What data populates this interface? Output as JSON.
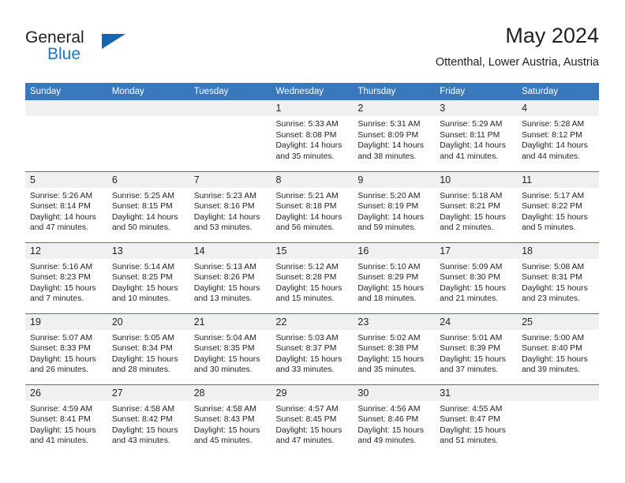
{
  "brand": {
    "name_part1": "General",
    "name_part2": "Blue",
    "triangle_color": "#1565b0",
    "blue_text_color": "#1a79c8"
  },
  "header": {
    "title": "May 2024",
    "location": "Ottenthal, Lower Austria, Austria",
    "header_bg": "#3a78bd",
    "daynum_bg": "#f0f0f0"
  },
  "weekday_headers": [
    "Sunday",
    "Monday",
    "Tuesday",
    "Wednesday",
    "Thursday",
    "Friday",
    "Saturday"
  ],
  "labels": {
    "sunrise_prefix": "Sunrise:",
    "sunset_prefix": "Sunset:",
    "daylight_prefix": "Daylight:"
  },
  "weeks": [
    [
      {
        "day": "",
        "sunrise": "",
        "sunset": "",
        "daylight_line1": "",
        "daylight_line2": ""
      },
      {
        "day": "",
        "sunrise": "",
        "sunset": "",
        "daylight_line1": "",
        "daylight_line2": ""
      },
      {
        "day": "",
        "sunrise": "",
        "sunset": "",
        "daylight_line1": "",
        "daylight_line2": ""
      },
      {
        "day": "1",
        "sunrise": "Sunrise: 5:33 AM",
        "sunset": "Sunset: 8:08 PM",
        "daylight_line1": "Daylight: 14 hours",
        "daylight_line2": "and 35 minutes."
      },
      {
        "day": "2",
        "sunrise": "Sunrise: 5:31 AM",
        "sunset": "Sunset: 8:09 PM",
        "daylight_line1": "Daylight: 14 hours",
        "daylight_line2": "and 38 minutes."
      },
      {
        "day": "3",
        "sunrise": "Sunrise: 5:29 AM",
        "sunset": "Sunset: 8:11 PM",
        "daylight_line1": "Daylight: 14 hours",
        "daylight_line2": "and 41 minutes."
      },
      {
        "day": "4",
        "sunrise": "Sunrise: 5:28 AM",
        "sunset": "Sunset: 8:12 PM",
        "daylight_line1": "Daylight: 14 hours",
        "daylight_line2": "and 44 minutes."
      }
    ],
    [
      {
        "day": "5",
        "sunrise": "Sunrise: 5:26 AM",
        "sunset": "Sunset: 8:14 PM",
        "daylight_line1": "Daylight: 14 hours",
        "daylight_line2": "and 47 minutes."
      },
      {
        "day": "6",
        "sunrise": "Sunrise: 5:25 AM",
        "sunset": "Sunset: 8:15 PM",
        "daylight_line1": "Daylight: 14 hours",
        "daylight_line2": "and 50 minutes."
      },
      {
        "day": "7",
        "sunrise": "Sunrise: 5:23 AM",
        "sunset": "Sunset: 8:16 PM",
        "daylight_line1": "Daylight: 14 hours",
        "daylight_line2": "and 53 minutes."
      },
      {
        "day": "8",
        "sunrise": "Sunrise: 5:21 AM",
        "sunset": "Sunset: 8:18 PM",
        "daylight_line1": "Daylight: 14 hours",
        "daylight_line2": "and 56 minutes."
      },
      {
        "day": "9",
        "sunrise": "Sunrise: 5:20 AM",
        "sunset": "Sunset: 8:19 PM",
        "daylight_line1": "Daylight: 14 hours",
        "daylight_line2": "and 59 minutes."
      },
      {
        "day": "10",
        "sunrise": "Sunrise: 5:18 AM",
        "sunset": "Sunset: 8:21 PM",
        "daylight_line1": "Daylight: 15 hours",
        "daylight_line2": "and 2 minutes."
      },
      {
        "day": "11",
        "sunrise": "Sunrise: 5:17 AM",
        "sunset": "Sunset: 8:22 PM",
        "daylight_line1": "Daylight: 15 hours",
        "daylight_line2": "and 5 minutes."
      }
    ],
    [
      {
        "day": "12",
        "sunrise": "Sunrise: 5:16 AM",
        "sunset": "Sunset: 8:23 PM",
        "daylight_line1": "Daylight: 15 hours",
        "daylight_line2": "and 7 minutes."
      },
      {
        "day": "13",
        "sunrise": "Sunrise: 5:14 AM",
        "sunset": "Sunset: 8:25 PM",
        "daylight_line1": "Daylight: 15 hours",
        "daylight_line2": "and 10 minutes."
      },
      {
        "day": "14",
        "sunrise": "Sunrise: 5:13 AM",
        "sunset": "Sunset: 8:26 PM",
        "daylight_line1": "Daylight: 15 hours",
        "daylight_line2": "and 13 minutes."
      },
      {
        "day": "15",
        "sunrise": "Sunrise: 5:12 AM",
        "sunset": "Sunset: 8:28 PM",
        "daylight_line1": "Daylight: 15 hours",
        "daylight_line2": "and 15 minutes."
      },
      {
        "day": "16",
        "sunrise": "Sunrise: 5:10 AM",
        "sunset": "Sunset: 8:29 PM",
        "daylight_line1": "Daylight: 15 hours",
        "daylight_line2": "and 18 minutes."
      },
      {
        "day": "17",
        "sunrise": "Sunrise: 5:09 AM",
        "sunset": "Sunset: 8:30 PM",
        "daylight_line1": "Daylight: 15 hours",
        "daylight_line2": "and 21 minutes."
      },
      {
        "day": "18",
        "sunrise": "Sunrise: 5:08 AM",
        "sunset": "Sunset: 8:31 PM",
        "daylight_line1": "Daylight: 15 hours",
        "daylight_line2": "and 23 minutes."
      }
    ],
    [
      {
        "day": "19",
        "sunrise": "Sunrise: 5:07 AM",
        "sunset": "Sunset: 8:33 PM",
        "daylight_line1": "Daylight: 15 hours",
        "daylight_line2": "and 26 minutes."
      },
      {
        "day": "20",
        "sunrise": "Sunrise: 5:05 AM",
        "sunset": "Sunset: 8:34 PM",
        "daylight_line1": "Daylight: 15 hours",
        "daylight_line2": "and 28 minutes."
      },
      {
        "day": "21",
        "sunrise": "Sunrise: 5:04 AM",
        "sunset": "Sunset: 8:35 PM",
        "daylight_line1": "Daylight: 15 hours",
        "daylight_line2": "and 30 minutes."
      },
      {
        "day": "22",
        "sunrise": "Sunrise: 5:03 AM",
        "sunset": "Sunset: 8:37 PM",
        "daylight_line1": "Daylight: 15 hours",
        "daylight_line2": "and 33 minutes."
      },
      {
        "day": "23",
        "sunrise": "Sunrise: 5:02 AM",
        "sunset": "Sunset: 8:38 PM",
        "daylight_line1": "Daylight: 15 hours",
        "daylight_line2": "and 35 minutes."
      },
      {
        "day": "24",
        "sunrise": "Sunrise: 5:01 AM",
        "sunset": "Sunset: 8:39 PM",
        "daylight_line1": "Daylight: 15 hours",
        "daylight_line2": "and 37 minutes."
      },
      {
        "day": "25",
        "sunrise": "Sunrise: 5:00 AM",
        "sunset": "Sunset: 8:40 PM",
        "daylight_line1": "Daylight: 15 hours",
        "daylight_line2": "and 39 minutes."
      }
    ],
    [
      {
        "day": "26",
        "sunrise": "Sunrise: 4:59 AM",
        "sunset": "Sunset: 8:41 PM",
        "daylight_line1": "Daylight: 15 hours",
        "daylight_line2": "and 41 minutes."
      },
      {
        "day": "27",
        "sunrise": "Sunrise: 4:58 AM",
        "sunset": "Sunset: 8:42 PM",
        "daylight_line1": "Daylight: 15 hours",
        "daylight_line2": "and 43 minutes."
      },
      {
        "day": "28",
        "sunrise": "Sunrise: 4:58 AM",
        "sunset": "Sunset: 8:43 PM",
        "daylight_line1": "Daylight: 15 hours",
        "daylight_line2": "and 45 minutes."
      },
      {
        "day": "29",
        "sunrise": "Sunrise: 4:57 AM",
        "sunset": "Sunset: 8:45 PM",
        "daylight_line1": "Daylight: 15 hours",
        "daylight_line2": "and 47 minutes."
      },
      {
        "day": "30",
        "sunrise": "Sunrise: 4:56 AM",
        "sunset": "Sunset: 8:46 PM",
        "daylight_line1": "Daylight: 15 hours",
        "daylight_line2": "and 49 minutes."
      },
      {
        "day": "31",
        "sunrise": "Sunrise: 4:55 AM",
        "sunset": "Sunset: 8:47 PM",
        "daylight_line1": "Daylight: 15 hours",
        "daylight_line2": "and 51 minutes."
      },
      {
        "day": "",
        "sunrise": "",
        "sunset": "",
        "daylight_line1": "",
        "daylight_line2": ""
      }
    ]
  ]
}
